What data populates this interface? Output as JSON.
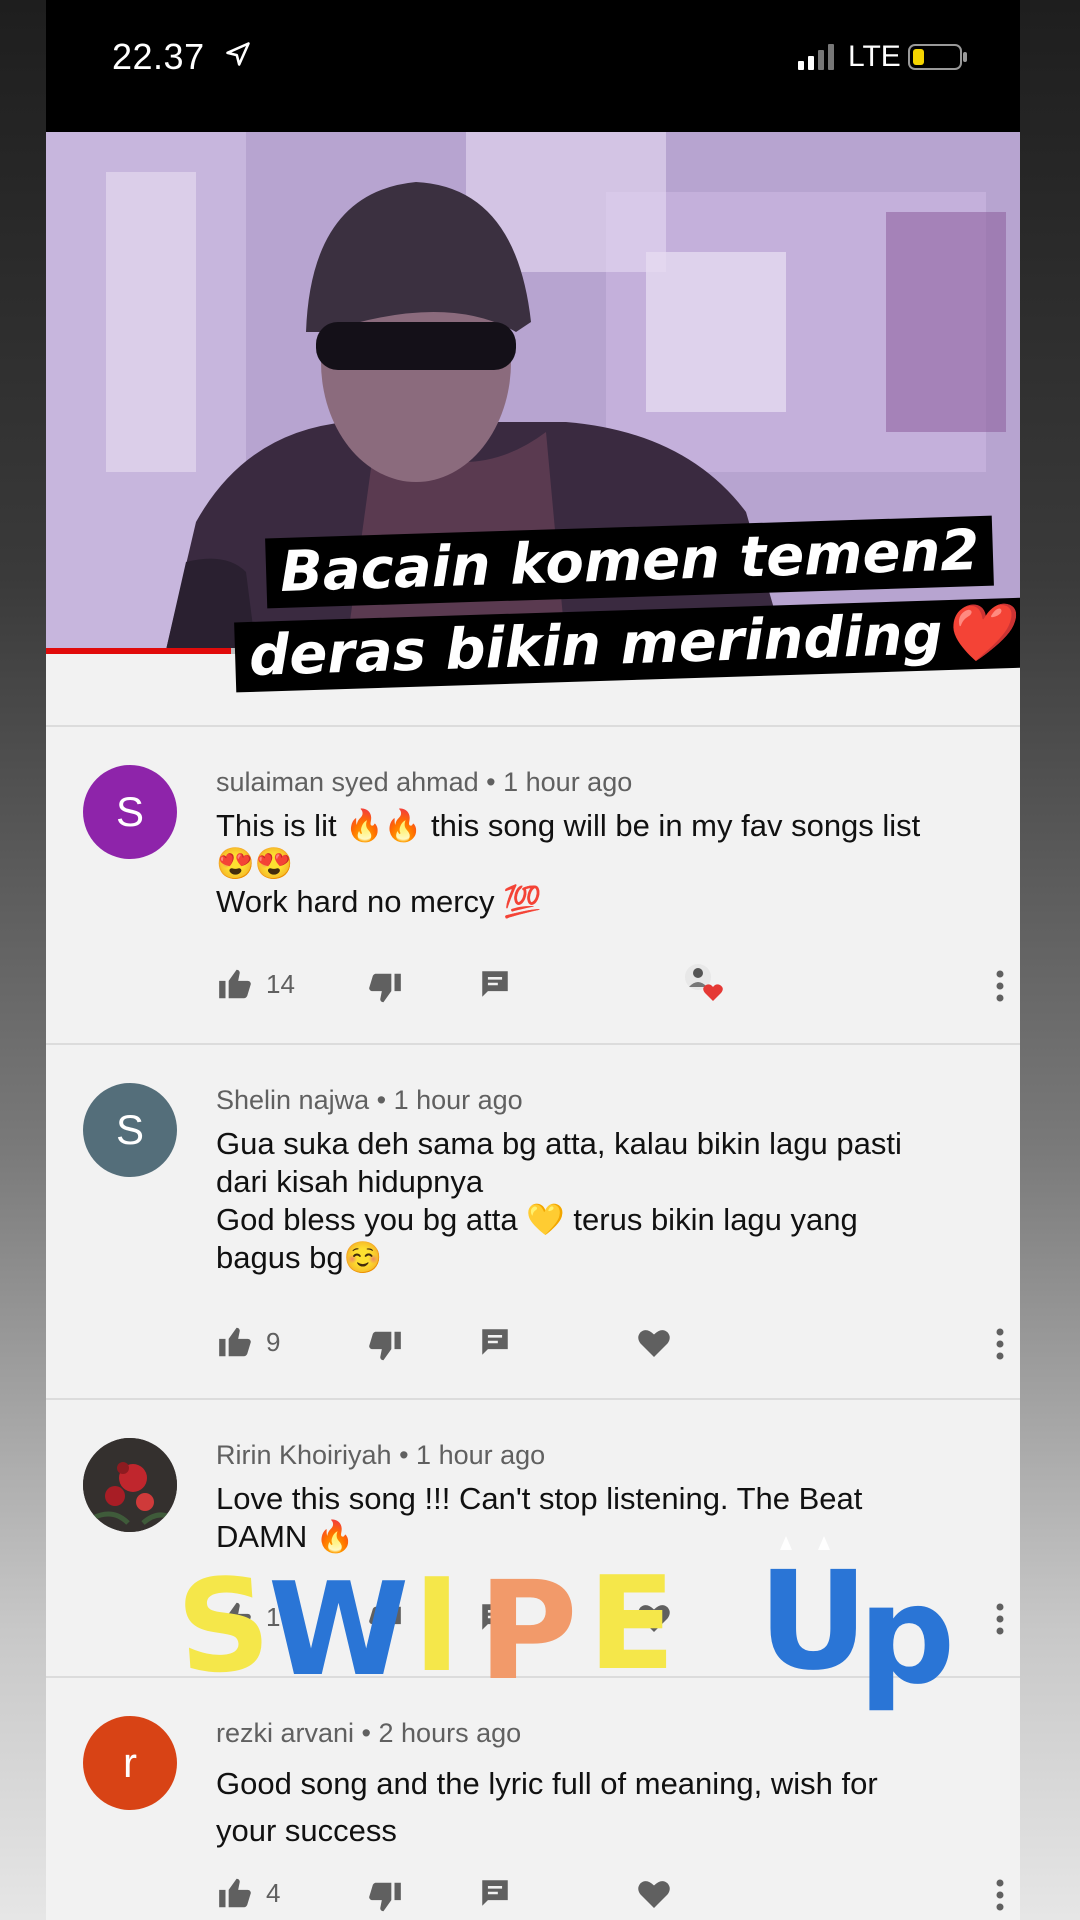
{
  "status_bar": {
    "time": "22.37",
    "network": "LTE"
  },
  "video": {
    "progress_fraction": 0.19
  },
  "story_caption": {
    "line1": "Bacain komen temen2",
    "line2": "deras bikin merinding",
    "emoji": "❤️"
  },
  "comments": [
    {
      "author": "sulaiman syed ahmad",
      "time": "1 hour ago",
      "avatar_letter": "S",
      "avatar_color": "#8e24aa",
      "lines": [
        "This is lit 🔥🔥 this song will be in my fav songs list",
        "😍😍",
        "Work hard no mercy 💯"
      ],
      "likes": "14",
      "creator_hearted": true
    },
    {
      "author": "Shelin najwa",
      "time": "1 hour ago",
      "avatar_letter": "S",
      "avatar_color": "#546e7a",
      "lines": [
        "Gua suka deh sama bg atta, kalau bikin lagu pasti",
        "dari kisah hidupnya",
        "God bless you bg atta 💛 terus bikin lagu yang",
        "bagus bg☺️"
      ],
      "likes": "9",
      "creator_hearted": false
    },
    {
      "author": "Ririn Khoiriyah",
      "time": "1 hour ago",
      "avatar_letter": "",
      "avatar_color": "#3b3030",
      "lines": [
        "Love this song !!! Can't stop listening. The Beat",
        "DAMN 🔥"
      ],
      "likes": "1",
      "creator_hearted": false
    },
    {
      "author": "rezki arvani",
      "time": "2 hours ago",
      "avatar_letter": "r",
      "avatar_color": "#d84315",
      "lines": [
        "Good song and the lyric full of meaning, wish for",
        "your success"
      ],
      "likes": "4",
      "creator_hearted": false
    }
  ],
  "sticker": {
    "text": "SWIPE UP",
    "colors": {
      "S": "#f5e74a",
      "W": "#2a75d6",
      "I": "#f5e74a",
      "P": "#f29a6a",
      "E": "#f5e74a",
      "U": "#2a75d6",
      "p": "#2a75d6"
    }
  },
  "colors": {
    "accent_red": "#e10b0b",
    "heart_red": "#e53935"
  }
}
